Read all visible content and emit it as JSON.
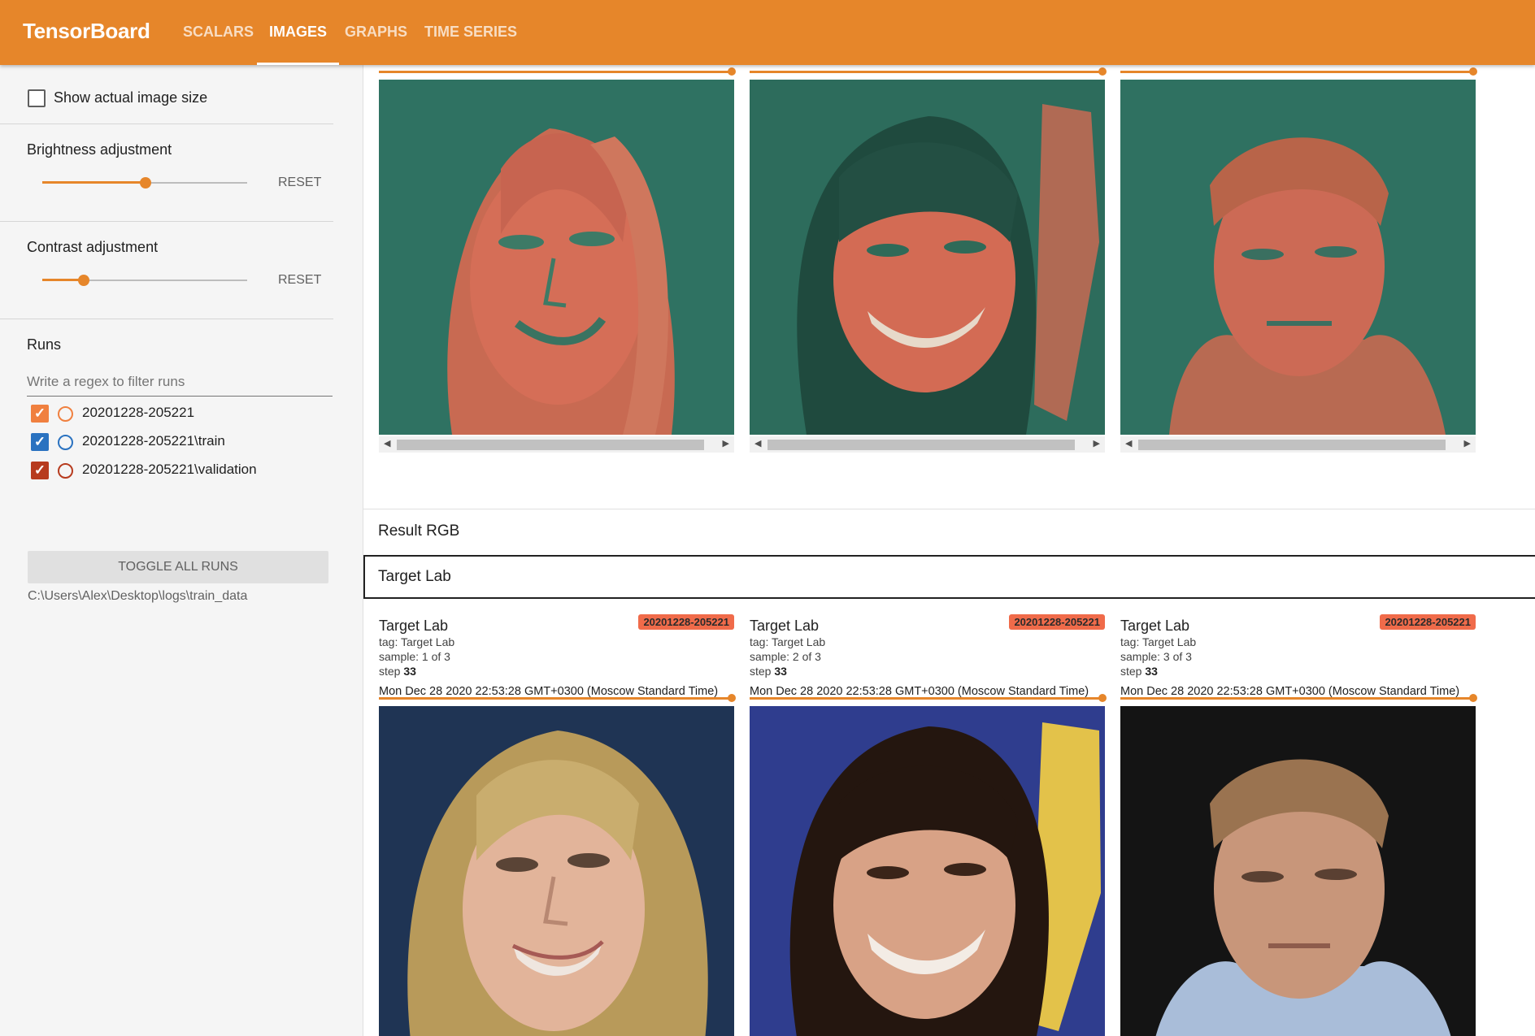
{
  "app": {
    "brand": "TensorBoard",
    "tabs": [
      {
        "label": "SCALARS",
        "active": false
      },
      {
        "label": "IMAGES",
        "active": true
      },
      {
        "label": "GRAPHS",
        "active": false
      },
      {
        "label": "TIME SERIES",
        "active": false
      }
    ],
    "accent_color": "#e6862a"
  },
  "sidebar": {
    "show_actual_size": {
      "label": "Show actual image size",
      "checked": false
    },
    "brightness": {
      "label": "Brightness adjustment",
      "value": 0.5,
      "reset_label": "RESET"
    },
    "contrast": {
      "label": "Contrast adjustment",
      "value": 0.2,
      "reset_label": "RESET"
    },
    "runs": {
      "heading": "Runs",
      "filter_placeholder": "Write a regex to filter runs",
      "items": [
        {
          "label": "20201228-205221",
          "checked": true,
          "color": "#f0803f"
        },
        {
          "label": "20201228-205221\\train",
          "checked": true,
          "color": "#2a72c0"
        },
        {
          "label": "20201228-205221\\validation",
          "checked": true,
          "color": "#b73b1e"
        }
      ],
      "toggle_label": "TOGGLE ALL RUNS",
      "logdir": "C:\\Users\\Alex\\Desktop\\logs\\train_data"
    }
  },
  "main": {
    "upper_cards": [
      {
        "image": "face-1-lab-false-color"
      },
      {
        "image": "face-2-lab-false-color"
      },
      {
        "image": "face-3-lab-false-color"
      }
    ],
    "section_result_rgb": "Result RGB",
    "section_target_lab": "Target Lab",
    "cards": [
      {
        "title": "Target Lab",
        "run": "20201228-205221",
        "tag": "tag: Target Lab",
        "sample": "sample: 1 of 3",
        "step_label": "step",
        "step": "33",
        "timestamp": "Mon Dec 28 2020 22:53:28 GMT+0300 (Moscow Standard Time)"
      },
      {
        "title": "Target Lab",
        "run": "20201228-205221",
        "tag": "tag: Target Lab",
        "sample": "sample: 2 of 3",
        "step_label": "step",
        "step": "33",
        "timestamp": "Mon Dec 28 2020 22:53:28 GMT+0300 (Moscow Standard Time)"
      },
      {
        "title": "Target Lab",
        "run": "20201228-205221",
        "tag": "tag: Target Lab",
        "sample": "sample: 3 of 3",
        "step_label": "step",
        "step": "33",
        "timestamp": "Mon Dec 28 2020 22:53:28 GMT+0300 (Moscow Standard Time)"
      }
    ]
  }
}
